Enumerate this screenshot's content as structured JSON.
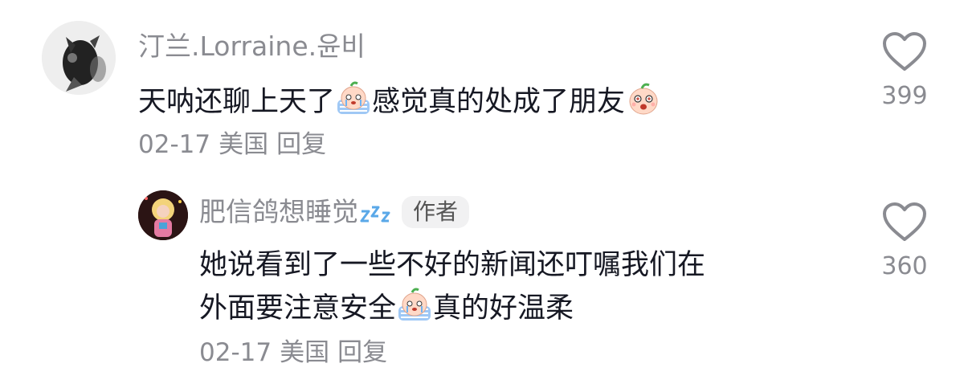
{
  "comments": [
    {
      "username": "汀兰.Lorraine.윤비",
      "text_before_emoji_1": "天呐还聊上天了",
      "emoji_1": "crying-emoji",
      "text_between_emojis": "感觉真的处成了朋友",
      "emoji_2": "surprised-emoji",
      "date": "02-17",
      "location": "美国",
      "reply_label": "回复",
      "likes": "399"
    },
    {
      "username": "肥信鸽想睡觉",
      "sleep_icon": "zzz-icon",
      "author_badge": "作者",
      "line_1": "她说看到了一些不好的新闻还叮嘱我们在",
      "line_2_before_emoji": "外面要注意安全",
      "emoji": "crying-emoji",
      "line_2_after_emoji": "真的好温柔",
      "date": "02-17",
      "location": "美国",
      "reply_label": "回复",
      "likes": "360"
    }
  ],
  "colors": {
    "secondary_text": "#8a8b91",
    "primary_text": "#161823",
    "badge_bg": "#f1f1f2",
    "zzz_blue": "#5aa8e8"
  }
}
